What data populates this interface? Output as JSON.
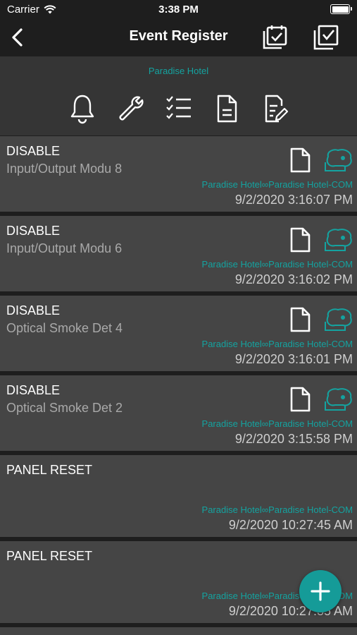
{
  "status_bar": {
    "carrier": "Carrier",
    "time": "3:38 PM"
  },
  "nav": {
    "title": "Event Register"
  },
  "header": {
    "site": "Paradise Hotel"
  },
  "toolbar": {
    "icons": [
      "bell-icon",
      "wrench-icon",
      "checklist-icon",
      "document-icon",
      "edit-document-icon"
    ]
  },
  "events": [
    {
      "event": "DISABLE",
      "device": "Input/Output Modu 8",
      "path": "Paradise Hotel∞Paradise Hotel-COM",
      "timestamp": "9/2/2020 3:16:07 PM",
      "has_icons": true
    },
    {
      "event": "DISABLE",
      "device": "Input/Output Modu 6",
      "path": "Paradise Hotel∞Paradise Hotel-COM",
      "timestamp": "9/2/2020 3:16:02 PM",
      "has_icons": true
    },
    {
      "event": "DISABLE",
      "device": "Optical Smoke Det 4",
      "path": "Paradise Hotel∞Paradise Hotel-COM",
      "timestamp": "9/2/2020 3:16:01 PM",
      "has_icons": true
    },
    {
      "event": "DISABLE",
      "device": "Optical Smoke Det 2",
      "path": "Paradise Hotel∞Paradise Hotel-COM",
      "timestamp": "9/2/2020 3:15:58 PM",
      "has_icons": true
    },
    {
      "event": "PANEL RESET",
      "device": "",
      "path": "Paradise Hotel∞Paradise Hotel-COM",
      "timestamp": "9/2/2020 10:27:45 AM",
      "has_icons": false
    },
    {
      "event": "PANEL RESET",
      "device": "",
      "path": "Paradise Hotel∞Paradise Hotel-COM",
      "timestamp": "9/2/2020 10:27:35 AM",
      "has_icons": false
    }
  ],
  "colors": {
    "accent": "#14a3a0",
    "fab": "#159b98",
    "row": "#454545",
    "header": "#353535"
  }
}
